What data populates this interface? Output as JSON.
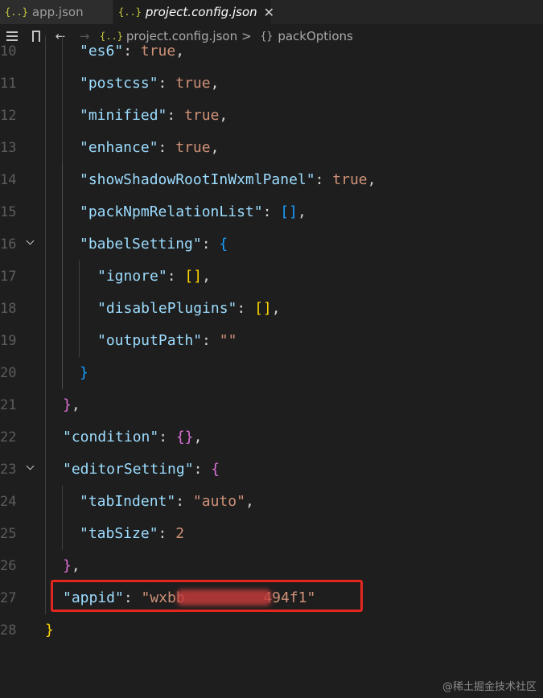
{
  "tabs": [
    {
      "icon": "{..}",
      "label": "app.json",
      "active": false
    },
    {
      "icon": "{..}",
      "label": "project.config.json",
      "active": true,
      "close": "✕"
    }
  ],
  "breadcrumb": {
    "file_icon": "{..}",
    "file": "project.config.json",
    "separator": ">",
    "obj_icon": "{}",
    "symbol": "packOptions"
  },
  "lines": [
    {
      "n": "10",
      "indent": 2,
      "tokens": [
        [
          "key",
          "\"es6\""
        ],
        [
          "pun",
          ": "
        ],
        [
          "kw",
          "true"
        ],
        [
          "pun",
          ","
        ]
      ]
    },
    {
      "n": "11",
      "indent": 2,
      "tokens": [
        [
          "key",
          "\"postcss\""
        ],
        [
          "pun",
          ": "
        ],
        [
          "kw",
          "true"
        ],
        [
          "pun",
          ","
        ]
      ]
    },
    {
      "n": "12",
      "indent": 2,
      "tokens": [
        [
          "key",
          "\"minified\""
        ],
        [
          "pun",
          ": "
        ],
        [
          "kw",
          "true"
        ],
        [
          "pun",
          ","
        ]
      ]
    },
    {
      "n": "13",
      "indent": 2,
      "tokens": [
        [
          "key",
          "\"enhance\""
        ],
        [
          "pun",
          ": "
        ],
        [
          "kw",
          "true"
        ],
        [
          "pun",
          ","
        ]
      ]
    },
    {
      "n": "14",
      "indent": 2,
      "tokens": [
        [
          "key",
          "\"showShadowRootInWxmlPanel\""
        ],
        [
          "pun",
          ": "
        ],
        [
          "kw",
          "true"
        ],
        [
          "pun",
          ","
        ]
      ]
    },
    {
      "n": "15",
      "indent": 2,
      "tokens": [
        [
          "key",
          "\"packNpmRelationList\""
        ],
        [
          "pun",
          ": "
        ],
        [
          "br3",
          "[]"
        ],
        [
          "pun",
          ","
        ]
      ]
    },
    {
      "n": "16",
      "indent": 2,
      "fold": true,
      "tokens": [
        [
          "key",
          "\"babelSetting\""
        ],
        [
          "pun",
          ": "
        ],
        [
          "br3",
          "{"
        ]
      ]
    },
    {
      "n": "17",
      "indent": 3,
      "tokens": [
        [
          "key",
          "\"ignore\""
        ],
        [
          "pun",
          ": "
        ],
        [
          "br1",
          "[]"
        ],
        [
          "pun",
          ","
        ]
      ]
    },
    {
      "n": "18",
      "indent": 3,
      "tokens": [
        [
          "key",
          "\"disablePlugins\""
        ],
        [
          "pun",
          ": "
        ],
        [
          "br1",
          "[]"
        ],
        [
          "pun",
          ","
        ]
      ]
    },
    {
      "n": "19",
      "indent": 3,
      "tokens": [
        [
          "key",
          "\"outputPath\""
        ],
        [
          "pun",
          ": "
        ],
        [
          "str",
          "\"\""
        ]
      ]
    },
    {
      "n": "20",
      "indent": 2,
      "tokens": [
        [
          "br3",
          "}"
        ]
      ]
    },
    {
      "n": "21",
      "indent": 1,
      "tokens": [
        [
          "br2",
          "}"
        ],
        [
          "pun",
          ","
        ]
      ]
    },
    {
      "n": "22",
      "indent": 1,
      "tokens": [
        [
          "key",
          "\"condition\""
        ],
        [
          "pun",
          ": "
        ],
        [
          "br2",
          "{}"
        ],
        [
          "pun",
          ","
        ]
      ]
    },
    {
      "n": "23",
      "indent": 1,
      "fold": true,
      "tokens": [
        [
          "key",
          "\"editorSetting\""
        ],
        [
          "pun",
          ": "
        ],
        [
          "br2",
          "{"
        ]
      ]
    },
    {
      "n": "24",
      "indent": 2,
      "tokens": [
        [
          "key",
          "\"tabIndent\""
        ],
        [
          "pun",
          ": "
        ],
        [
          "str",
          "\"auto\""
        ],
        [
          "pun",
          ","
        ]
      ]
    },
    {
      "n": "25",
      "indent": 2,
      "tokens": [
        [
          "key",
          "\"tabSize\""
        ],
        [
          "pun",
          ": "
        ],
        [
          "kw",
          "2"
        ]
      ]
    },
    {
      "n": "26",
      "indent": 1,
      "tokens": [
        [
          "br2",
          "}"
        ],
        [
          "pun",
          ","
        ]
      ]
    },
    {
      "n": "27",
      "indent": 1,
      "tokens": [
        [
          "key",
          "\"appid\""
        ],
        [
          "pun",
          ": "
        ],
        [
          "str",
          "\"wxbb"
        ],
        [
          "pun",
          "         "
        ],
        [
          "str",
          "494f1\""
        ]
      ]
    },
    {
      "n": "28",
      "indent": 0,
      "tokens": [
        [
          "br1",
          "}"
        ]
      ]
    }
  ],
  "watermark": "@稀土掘金技术社区",
  "colors": {
    "highlight_box": "#e5261f",
    "redaction": "#c23b3b"
  }
}
